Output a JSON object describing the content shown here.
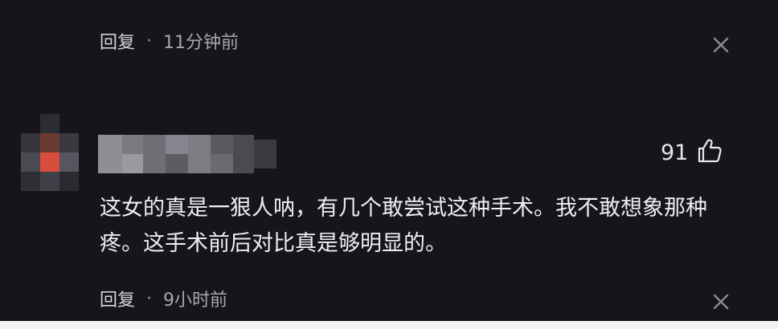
{
  "top_comment_meta": {
    "reply_label": "回复",
    "separator": "·",
    "time": "11分钟前"
  },
  "comment": {
    "likes": "91",
    "text": "这女的真是一狠人呐，有几个敢尝试这种手术。我不敢想象那种疼。这手术前后对比真是够明显的。",
    "meta": {
      "reply_label": "回复",
      "separator": "·",
      "time": "9小时前"
    }
  },
  "icons": {
    "close": "close-icon",
    "like": "thumbs-up-icon"
  },
  "colors": {
    "background": "#16161a",
    "primary_text": "#eeeef1",
    "secondary_text": "#a6a7ad"
  }
}
